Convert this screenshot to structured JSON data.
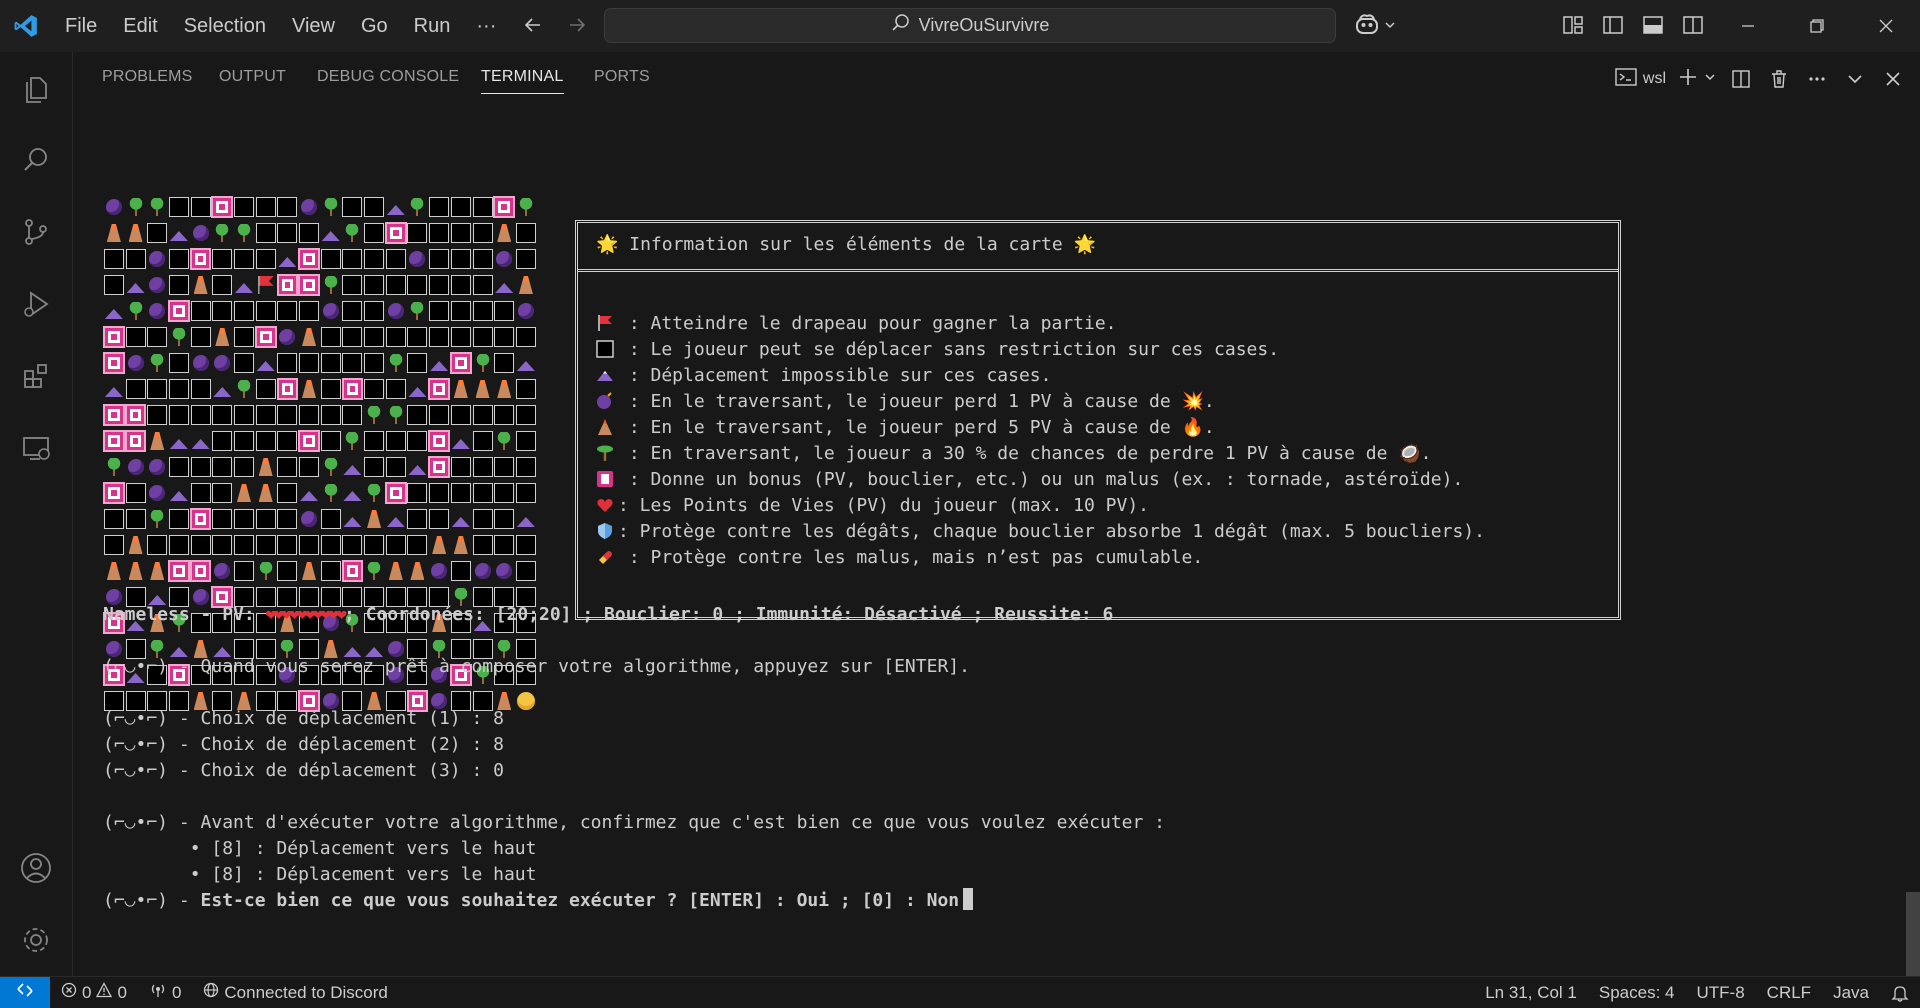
{
  "title_bar": {
    "menu": [
      "File",
      "Edit",
      "Selection",
      "View",
      "Go",
      "Run",
      "···"
    ],
    "search_text": "VivreOuSurvivre"
  },
  "panel": {
    "tabs": [
      "PROBLEMS",
      "OUTPUT",
      "DEBUG CONSOLE",
      "TERMINAL",
      "PORTS"
    ],
    "active_tab": "TERMINAL",
    "terminal_name": "wsl"
  },
  "map": {
    "rows": [
      "BPPEEKEEEBPEEMPEEEKP",
      "VVEMBPPEEEMPEKEEEEVE",
      "EEBEKEEEMKEEEEBEEEBE",
      "EMBEVEMFKKPEEEEEEEMV",
      "MPBKEEEEEEBEEBPEEEEB",
      "KEEPEVEKBVEEEEEEEEEE",
      "KBPEBBEMEEEEEPEMKPEM",
      "MEEEEMPEKVEKEEMKVVVE",
      "KKEEEEEEEEEEPPEEEEEE",
      "KKVMMEEEEKEPEEEKMEPE",
      "PBBEEEEVEEPMEEMKEEEE",
      "KEBMEEVVEMPMPKEEEEEE",
      "EEPEKEEEEBEMVMEEMEEM",
      "EVEEEEEEEEEEEEEVVEEE",
      "VVVKKBEPEVEKPVVBEBBE",
      "BEMEBKEEEEEEEEEEPEEE",
      "KMVPEEEEVEBPEEEVEMEE",
      "BEPMVMEEPEVMMBEPEEPE",
      "KMEKEEEEBEEEEBEBKPEE",
      "EEEEVEVEEKBEVEKBEEVH"
    ]
  },
  "info": {
    "title": "🌟 Information sur les éléments de la carte 🌟",
    "lines": [
      {
        "sym": "flag-icon",
        "text": " : Atteindre le drapeau pour gagner la partie."
      },
      {
        "sym": "empty-cell-icon",
        "text": " : Le joueur peut se déplacer sans restriction sur ces cases."
      },
      {
        "sym": "mountain-icon",
        "text": " : Déplacement impossible sur ces cases."
      },
      {
        "sym": "bomb-icon",
        "text": " : En le traversant, le joueur perd 1 PV à cause de 💥."
      },
      {
        "sym": "volcano-icon",
        "text": " : En le traversant, le joueur perd 5 PV à cause de 🔥."
      },
      {
        "sym": "palm-tree-icon",
        "text": " : En traversant, le joueur a 30 % de chances de perdre 1 PV à cause de 🥥."
      },
      {
        "sym": "bonus-card-icon",
        "text": " : Donne un bonus (PV, bouclier, etc.) ou un malus (ex. : tornade, astéroïde)."
      },
      {
        "sym": "heart-icon",
        "text": ": Les Points de Vies (PV) du joueur (max. 10 PV)."
      },
      {
        "sym": "shield-icon",
        "text": ": Protège contre les dégâts, chaque bouclier absorbe 1 dégât (max. 5 boucliers)."
      },
      {
        "sym": "pill-icon",
        "text": " : Protège contre les malus, mais n’est pas cumulable."
      }
    ]
  },
  "status_line": {
    "prefix": "Nameless - PV: ",
    "hearts": "❤❤❤❤❤❤❤❤❤❤",
    "suffix": "; Coordonées: [20;20] ; Bouclier: 0 ; Immunité: Désactivé ; Reussite: 6"
  },
  "output": [
    "(⌐◡•⌐) - Quand vous serez prêt à composer votre algorithme, appuyez sur [ENTER].",
    "(⌐◡•⌐) - Choix de déplacement (1) : 8",
    "(⌐◡•⌐) - Choix de déplacement (2) : 8",
    "(⌐◡•⌐) - Choix de déplacement (3) : 0",
    "(⌐◡•⌐) - Avant d'exécuter votre algorithme, confirmez que c'est bien ce que vous voulez exécuter :",
    "        • [8] : Déplacement vers le haut",
    "        • [8] : Déplacement vers le haut"
  ],
  "prompt": {
    "prefix": "(⌐◡•⌐) - ",
    "question": "Est-ce bien ce que vous souhaitez exécuter ? [ENTER] : Oui ; [0] : Non"
  },
  "statusbar": {
    "errors": "0",
    "warnings": "0",
    "ports": "0",
    "discord": "Connected to Discord",
    "position": "Ln 31, Col 1",
    "spaces": "Spaces: 4",
    "encoding": "UTF-8",
    "eol": "CRLF",
    "language": "Java"
  },
  "colors": {
    "accent": "#0078d4",
    "background": "#181818",
    "titlebar": "#1f1f1f",
    "heart": "#e0303a"
  }
}
